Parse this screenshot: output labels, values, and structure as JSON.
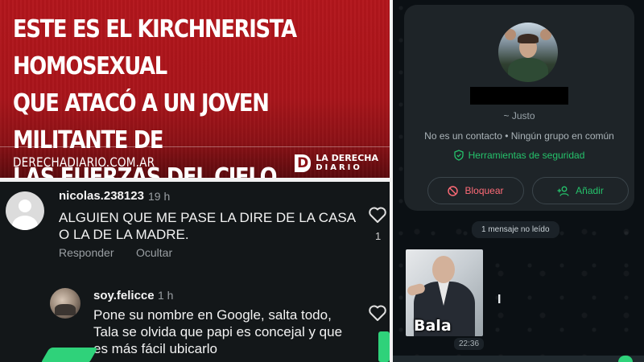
{
  "banner": {
    "headline": [
      "ESTE ES EL KIRCHNERISTA HOMOSEXUAL",
      "QUE ATACÓ A UN JOVEN MILITANTE DE",
      "LAS FUERZAS DEL CIELO"
    ],
    "site_url": "DERECHADIARIO.COM.AR",
    "brand_mark": "D",
    "brand_line1": "LA DERECHA",
    "brand_line2": "DIARIO"
  },
  "comments": [
    {
      "username": "nicolas.238123",
      "time": "19 h",
      "text": "ALGUIEN QUE ME PASE LA DIRE DE LA CASA O LA DE LA MADRE.",
      "reply_label": "Responder",
      "hide_label": "Ocultar",
      "likes": "1"
    },
    {
      "username": "soy.felicce",
      "time": "1 h",
      "text": "Pone su nombre en Google, salta todo, Tala se olvida que papi es concejal y que es más fácil ubicarlo"
    }
  ],
  "chat": {
    "nickname": "~ Justo",
    "contact_info": "No es un contacto • Ningún grupo en común",
    "security_label": "Herramientas de seguridad",
    "block_label": "Bloquear",
    "add_label": "Añadir",
    "unread_label": "1 mensaje no leído",
    "media_caption": "Bala",
    "message_time": "22:36",
    "cursor_glyph": "I"
  },
  "colors": {
    "banner_red": "#b3161c",
    "accent_green": "#25c26b",
    "block_red": "#ff6b77"
  }
}
